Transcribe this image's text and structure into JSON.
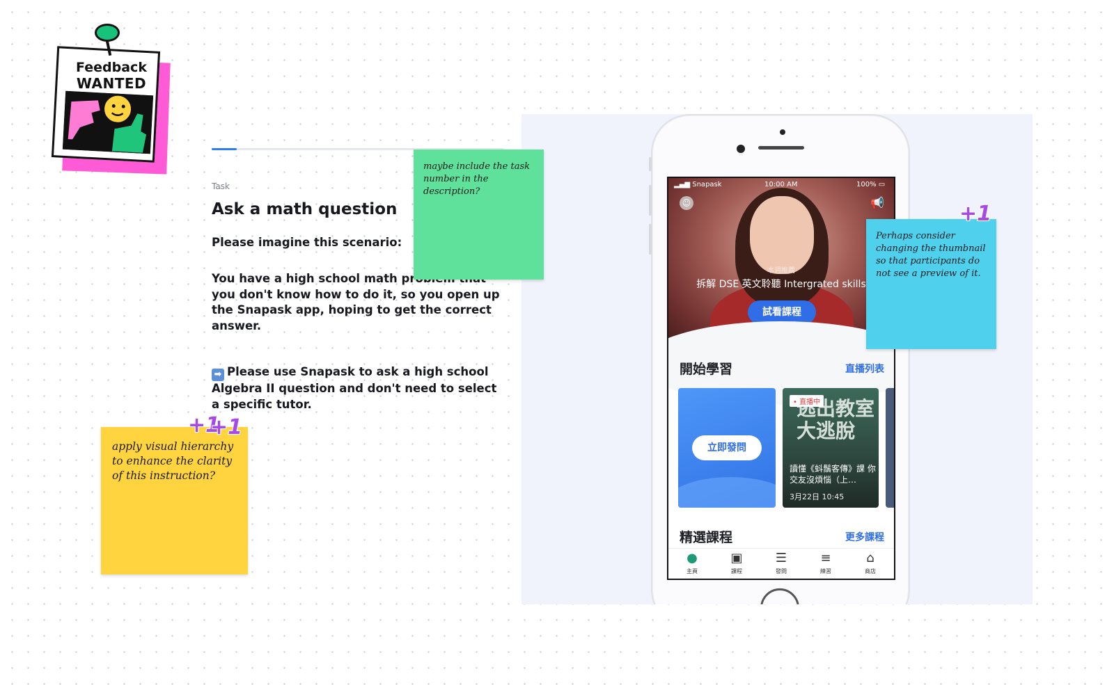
{
  "badge": {
    "line1": "Feedback",
    "line2": "WANTED"
  },
  "task": {
    "progress_fraction": 0.085,
    "label": "Task",
    "title": "Ask a math question",
    "scenario_heading": "Please imagine this scenario:",
    "scenario_text": "You have a high school math problem that you don't know how to do it, so you open up the Snapask app, hoping to get the correct answer.",
    "instruction_arrow": "➡",
    "instruction_text": "Please use Snapask to ask a high school Algebra II question and don't need to select a specific tutor."
  },
  "phone": {
    "status": {
      "carrier": "Snapask",
      "time": "10:00 AM",
      "battery": "100%"
    },
    "hero": {
      "tag": "本週推薦",
      "headline": "拆解 DSE 英文聆聽 Intergrated skills",
      "cta": "試看課程"
    },
    "section1": {
      "title": "開始學習",
      "link": "直播列表"
    },
    "card_ask": {
      "button": "立即發問"
    },
    "card_live": {
      "badge": "• 直播中",
      "big_text": "逃出教室大逃脫",
      "caption": "讀懂《蚪鬚客傳》課 你交友沒煩惱（上…",
      "date": "3月22日 10:45"
    },
    "section2": {
      "title": "精選課程",
      "link": "更多課程"
    },
    "tabs": [
      {
        "icon": "home-icon",
        "label": "主頁"
      },
      {
        "icon": "course-icon",
        "label": "課程"
      },
      {
        "icon": "ask-icon",
        "label": "發問"
      },
      {
        "icon": "practice-icon",
        "label": "練習"
      },
      {
        "icon": "shop-icon",
        "label": "商店"
      }
    ]
  },
  "notes": {
    "green": "maybe include the task number in the description?",
    "cyan": "Perhaps consider changing the thumbnail so that participants do not see a preview of it.",
    "yellow": "apply visual hierarchy to enhance the clarity of this instruction?"
  },
  "votes": {
    "cyan": "+1",
    "yellow_1": "+1",
    "yellow_2": "+1"
  },
  "colors": {
    "green_note": "#5fe09b",
    "cyan_note": "#4fd1ee",
    "yellow_note": "#ffd43f",
    "accent": "#2f6ee6",
    "vote": "#a64ae6",
    "badge_pink": "#ff5bd6"
  }
}
